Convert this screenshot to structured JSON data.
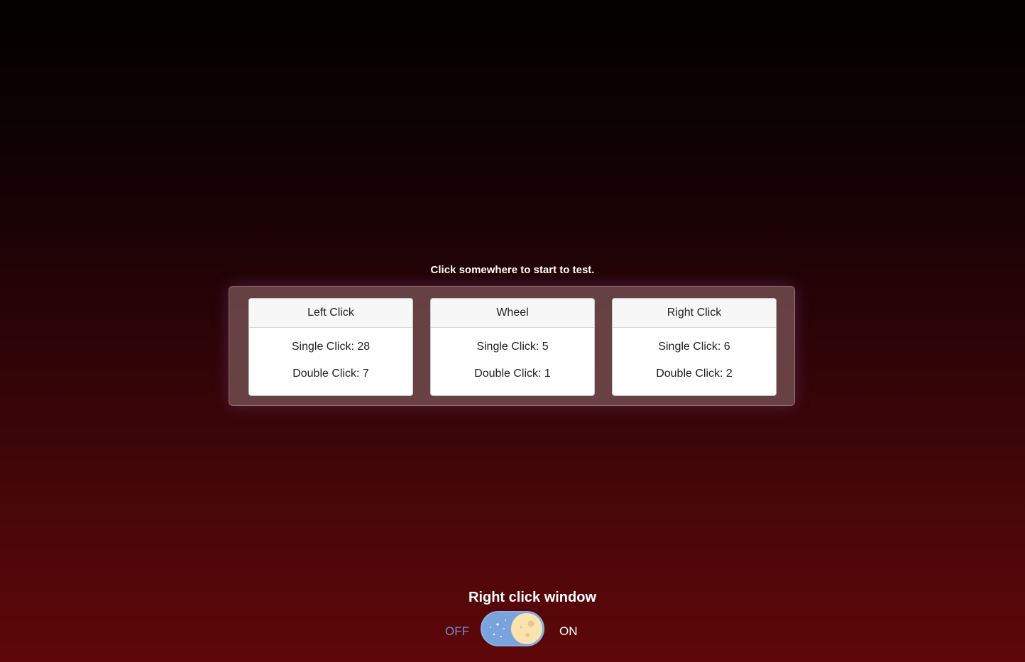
{
  "instruction": "Click somewhere to start to test.",
  "cards": [
    {
      "title": "Left Click",
      "single": "Single Click: 28",
      "double": "Double Click: 7"
    },
    {
      "title": "Wheel",
      "single": "Single Click: 5",
      "double": "Double Click: 1"
    },
    {
      "title": "Right Click",
      "single": "Single Click: 6",
      "double": "Double Click: 2"
    }
  ],
  "toggle": {
    "title": "Right click window",
    "off_label": "OFF",
    "on_label": "ON",
    "state": "on",
    "icon": "moon-icon"
  },
  "colors": {
    "toggle_track": "#7aa3dd",
    "moon": "#fbe3b0",
    "off_label": "#6f8fd0"
  }
}
